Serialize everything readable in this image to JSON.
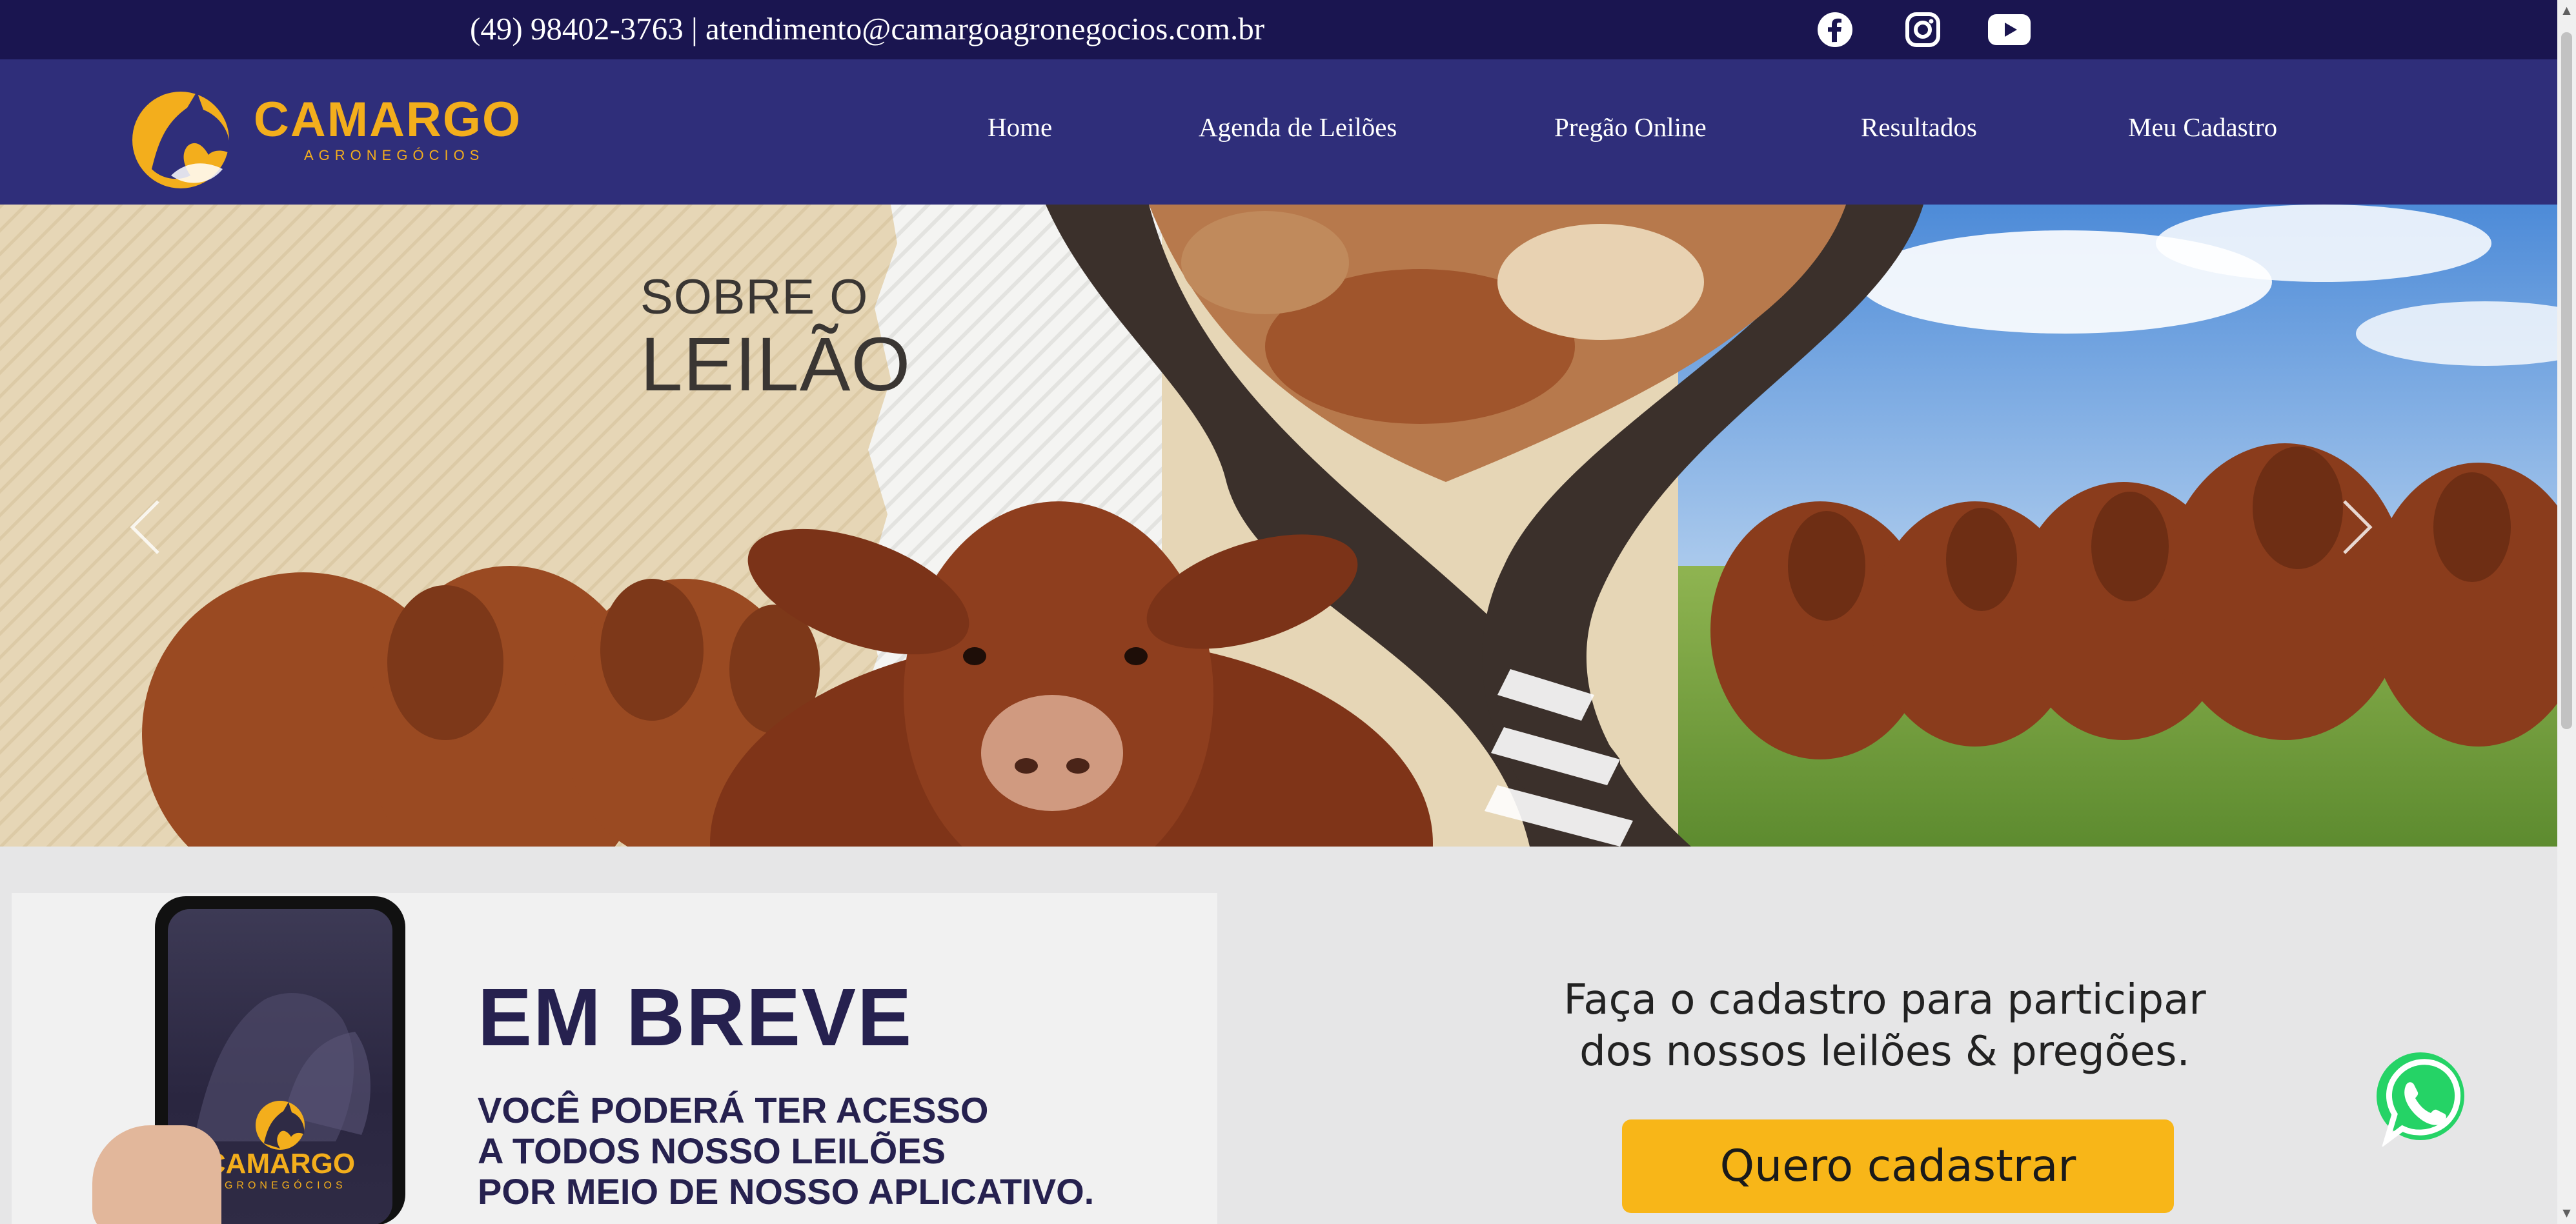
{
  "topbar": {
    "contact": "(49) 98402-3763 | atendimento@camargoagronegocios.com.br",
    "social_icons": [
      "facebook-icon",
      "instagram-icon",
      "youtube-icon"
    ]
  },
  "brand": {
    "name": "CAMARGO",
    "subtitle": "AGRONEGÓCIOS",
    "accent_color": "#f3ae1c",
    "nav_color": "#2f2e7a",
    "topbar_color": "#1a1550"
  },
  "nav": {
    "items": [
      {
        "label": "Home"
      },
      {
        "label": "Agenda de Leilões"
      },
      {
        "label": "Pregão Online"
      },
      {
        "label": "Resultados"
      },
      {
        "label": "Meu Cadastro"
      }
    ]
  },
  "hero": {
    "title_line1": "SOBRE O",
    "title_line2": "LEILÃO",
    "prev_icon": "chevron-left-icon",
    "next_icon": "chevron-right-icon"
  },
  "banner": {
    "headline": "EM BREVE",
    "lines": [
      "VOCÊ PODERÁ TER ACESSO",
      "A TODOS NOSSO LEILÕES",
      "POR MEIO DE NOSSO APLICATIVO."
    ],
    "phone_logo": "CAMARGO",
    "phone_sub": "AGRONEGÓCIOS"
  },
  "cta": {
    "line1": "Faça o cadastro para participar",
    "line2": "dos nossos leilões & pregões.",
    "button_label": "Quero cadastrar",
    "button_color": "#f8b618"
  },
  "whatsapp": {
    "icon": "whatsapp-icon",
    "color": "#25d366"
  }
}
